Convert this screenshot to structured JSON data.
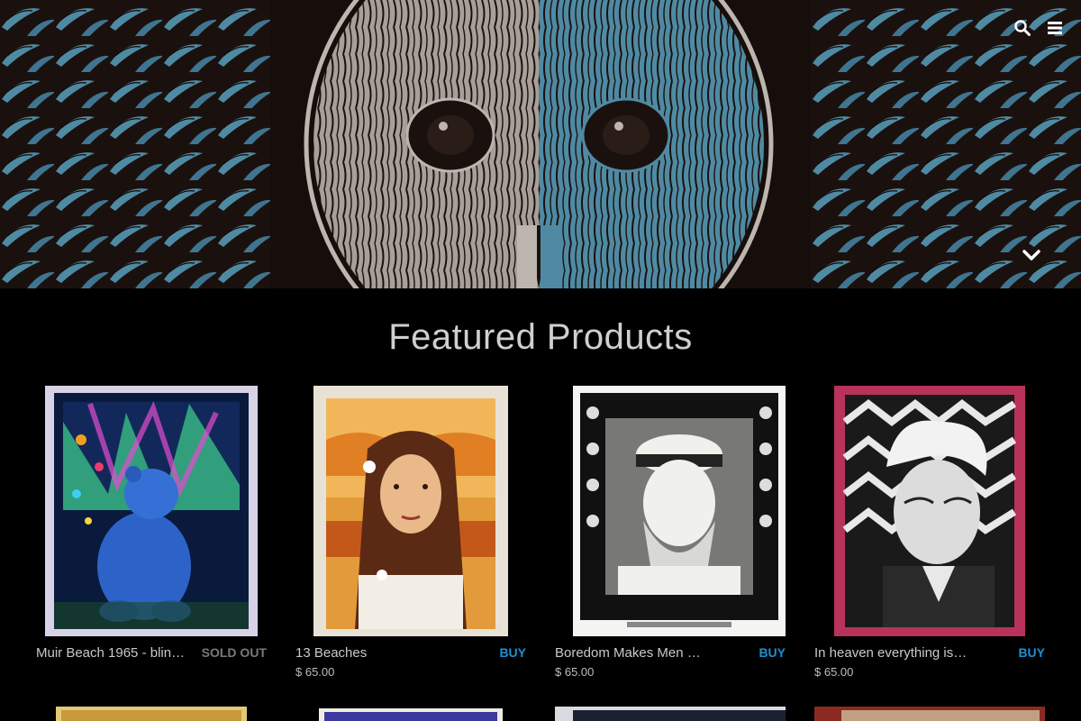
{
  "header": {
    "search_icon": "search-icon",
    "menu_icon": "hamburger-menu-icon",
    "scroll_icon": "chevron-down-icon"
  },
  "hero": {
    "colors": {
      "background": "#1a110e",
      "feather_blue": "#4f8aa3",
      "feather_grey": "#bdb6ae"
    }
  },
  "featured": {
    "title": "Featured Products",
    "products": [
      {
        "name": "Muir Beach 1965 - blin…",
        "action": "SOLD OUT",
        "price": ""
      },
      {
        "name": "13 Beaches",
        "action": "BUY",
        "price": "$ 65.00"
      },
      {
        "name": "Boredom Makes Men …",
        "action": "BUY",
        "price": "$ 65.00"
      },
      {
        "name": "In heaven everything is …",
        "action": "BUY",
        "price": "$ 65.00"
      }
    ]
  },
  "colors": {
    "buy": "#1e8fd6",
    "sold_out": "#7a7a7a",
    "background": "#000000"
  }
}
